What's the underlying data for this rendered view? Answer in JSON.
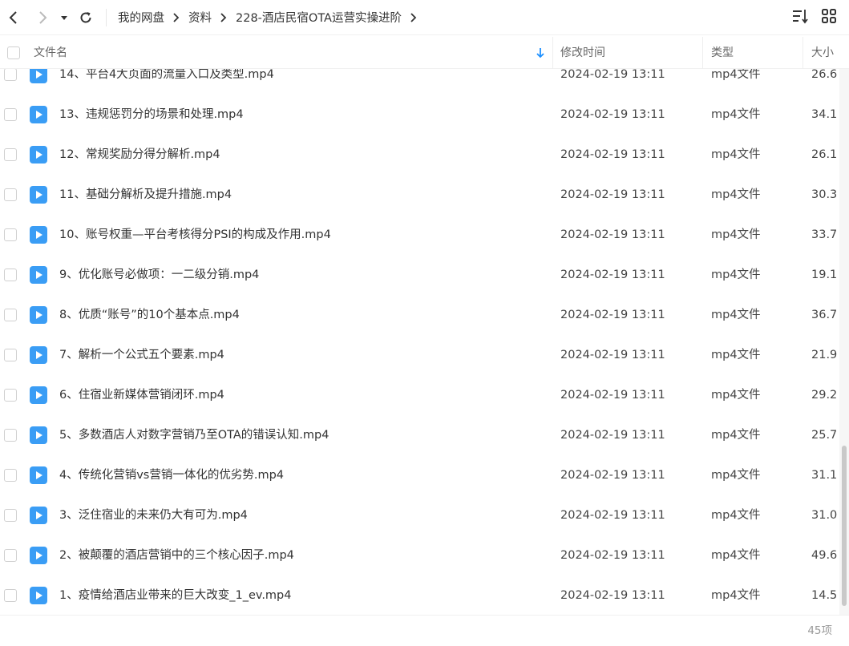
{
  "breadcrumb": [
    "我的网盘",
    "资料",
    "228-酒店民宿OTA运营实操进阶"
  ],
  "columns": {
    "name": "文件名",
    "modified": "修改时间",
    "type": "类型",
    "size": "大小"
  },
  "files": [
    {
      "name": "14、平台4大页面的流量入口及类型.mp4",
      "modified": "2024-02-19 13:11",
      "type": "mp4文件",
      "size": "26.6"
    },
    {
      "name": "13、违规惩罚分的场景和处理.mp4",
      "modified": "2024-02-19 13:11",
      "type": "mp4文件",
      "size": "34.1"
    },
    {
      "name": "12、常规奖励分得分解析.mp4",
      "modified": "2024-02-19 13:11",
      "type": "mp4文件",
      "size": "26.1"
    },
    {
      "name": "11、基础分解析及提升措施.mp4",
      "modified": "2024-02-19 13:11",
      "type": "mp4文件",
      "size": "30.3"
    },
    {
      "name": "10、账号权重—平台考核得分PSI的构成及作用.mp4",
      "modified": "2024-02-19 13:11",
      "type": "mp4文件",
      "size": "33.7"
    },
    {
      "name": "9、优化账号必做项：一二级分销.mp4",
      "modified": "2024-02-19 13:11",
      "type": "mp4文件",
      "size": "19.1"
    },
    {
      "name": "8、优质“账号”的10个基本点.mp4",
      "modified": "2024-02-19 13:11",
      "type": "mp4文件",
      "size": "36.7"
    },
    {
      "name": "7、解析一个公式五个要素.mp4",
      "modified": "2024-02-19 13:11",
      "type": "mp4文件",
      "size": "21.9"
    },
    {
      "name": "6、住宿业新媒体营销闭环.mp4",
      "modified": "2024-02-19 13:11",
      "type": "mp4文件",
      "size": "29.2"
    },
    {
      "name": "5、多数酒店人对数字营销乃至OTA的错误认知.mp4",
      "modified": "2024-02-19 13:11",
      "type": "mp4文件",
      "size": "25.7"
    },
    {
      "name": "4、传统化营销vs营销一体化的优劣势.mp4",
      "modified": "2024-02-19 13:11",
      "type": "mp4文件",
      "size": "31.1"
    },
    {
      "name": "3、泛住宿业的未来仍大有可为.mp4",
      "modified": "2024-02-19 13:11",
      "type": "mp4文件",
      "size": "31.0"
    },
    {
      "name": "2、被颠覆的酒店营销中的三个核心因子.mp4",
      "modified": "2024-02-19 13:11",
      "type": "mp4文件",
      "size": "49.6"
    },
    {
      "name": "1、疫情给酒店业带来的巨大改变_1_ev.mp4",
      "modified": "2024-02-19 13:11",
      "type": "mp4文件",
      "size": "14.5"
    }
  ],
  "footer": {
    "count": "45项"
  },
  "colors": {
    "accent": "#3a9df5",
    "sort_arrow": "#1e90ff"
  },
  "icons": {
    "back": "chevron-left-icon",
    "forward": "chevron-right-icon",
    "history": "dropdown-caret-icon",
    "refresh": "refresh-icon",
    "sort": "sort-list-icon",
    "view": "grid-view-icon",
    "file": "video-file-icon"
  }
}
